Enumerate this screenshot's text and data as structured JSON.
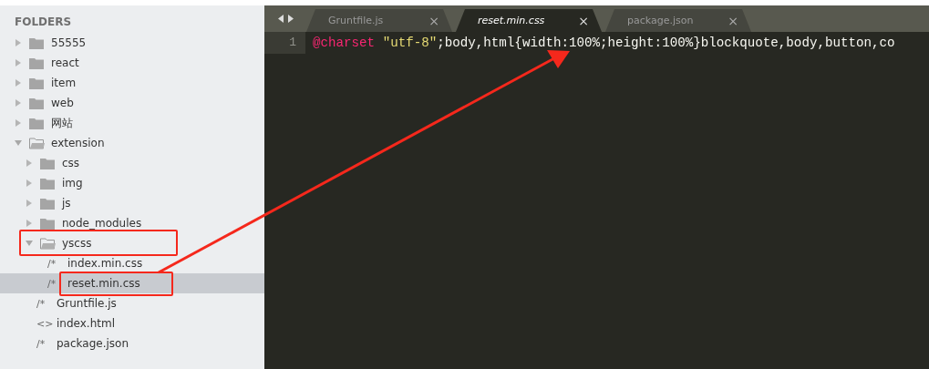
{
  "sidebar": {
    "title": "FOLDERS",
    "tree": [
      {
        "kind": "folder",
        "name": "55555",
        "expanded": false
      },
      {
        "kind": "folder",
        "name": "react",
        "expanded": false
      },
      {
        "kind": "folder",
        "name": "item",
        "expanded": false
      },
      {
        "kind": "folder",
        "name": "web",
        "expanded": false
      },
      {
        "kind": "folder",
        "name": "网站",
        "expanded": false
      },
      {
        "kind": "folder",
        "name": "extension",
        "expanded": true,
        "children": [
          {
            "kind": "folder",
            "name": "css",
            "expanded": false
          },
          {
            "kind": "folder",
            "name": "img",
            "expanded": false
          },
          {
            "kind": "folder",
            "name": "js",
            "expanded": false
          },
          {
            "kind": "folder",
            "name": "node_modules",
            "expanded": false
          },
          {
            "kind": "folder",
            "name": "yscss",
            "expanded": true,
            "highlighted": true,
            "children": [
              {
                "kind": "file",
                "icon": "/*",
                "name": "index.min.css",
                "selected": false,
                "highlighted": false
              },
              {
                "kind": "file",
                "icon": "/*",
                "name": "reset.min.css",
                "selected": true,
                "highlighted": true
              }
            ]
          },
          {
            "kind": "file",
            "icon": "/*",
            "name": "Gruntfile.js",
            "selected": false,
            "highlighted": false
          },
          {
            "kind": "file",
            "icon": "<>",
            "name": "index.html",
            "selected": false,
            "highlighted": false
          },
          {
            "kind": "file",
            "icon": "/*",
            "name": "package.json",
            "selected": false,
            "highlighted": false
          }
        ]
      }
    ]
  },
  "tabs": [
    {
      "label": "Gruntfile.js",
      "selected": false,
      "close": "×"
    },
    {
      "label": "reset.min.css",
      "selected": true,
      "close": "×"
    },
    {
      "label": "package.json",
      "selected": false,
      "close": "×"
    }
  ],
  "editor": {
    "lines": [
      {
        "number": "1",
        "tokens": [
          {
            "kind": "keyword",
            "text": "@charset"
          },
          {
            "kind": "string",
            "text": "\"utf-8\""
          },
          {
            "kind": "plain",
            "text": ";body,html{width:100%;height:100%}blockquote,body,button,co"
          }
        ]
      }
    ]
  }
}
